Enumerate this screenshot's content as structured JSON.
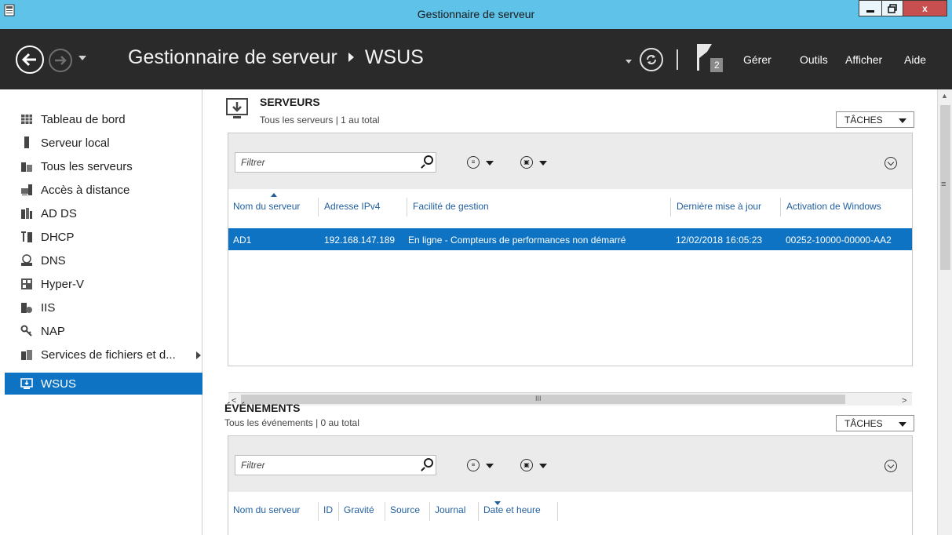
{
  "window": {
    "title": "Gestionnaire de serveur",
    "min_glyph": "▁",
    "max_glyph": "❐",
    "close_glyph": "x"
  },
  "header": {
    "app_name": "Gestionnaire de serveur",
    "current_page": "WSUS",
    "notification_count": "2",
    "menus": [
      "Gérer",
      "Outils",
      "Afficher",
      "Aide"
    ]
  },
  "sidebar": {
    "items": [
      {
        "label": "Tableau de bord",
        "icon": "dashboard-icon"
      },
      {
        "label": "Serveur local",
        "icon": "local-server-icon"
      },
      {
        "label": "Tous les serveurs",
        "icon": "all-servers-icon"
      },
      {
        "label": "Accès à distance",
        "icon": "remote-access-icon"
      },
      {
        "label": "AD DS",
        "icon": "ad-ds-icon"
      },
      {
        "label": "DHCP",
        "icon": "dhcp-icon"
      },
      {
        "label": "DNS",
        "icon": "dns-icon"
      },
      {
        "label": "Hyper-V",
        "icon": "hyper-v-icon"
      },
      {
        "label": "IIS",
        "icon": "iis-icon"
      },
      {
        "label": "NAP",
        "icon": "nap-icon"
      },
      {
        "label": "Services de fichiers et d...",
        "icon": "file-services-icon"
      },
      {
        "label": "WSUS",
        "icon": "wsus-icon",
        "active": true
      }
    ]
  },
  "servers": {
    "title": "SERVEURS",
    "subtitle": "Tous les serveurs | 1 au total",
    "tasks_label": "TÂCHES",
    "filter_placeholder": "Filtrer",
    "columns": [
      "Nom du serveur",
      "Adresse IPv4",
      "Facilité de gestion",
      "Dernière mise à jour",
      "Activation de Windows"
    ],
    "rows": [
      [
        "AD1",
        "192.168.147.189",
        "En ligne - Compteurs de performances non démarré",
        "12/02/2018 16:05:23",
        "00252-10000-00000-AA2"
      ]
    ],
    "scroll_left": "<",
    "scroll_right": ">",
    "scroll_grip": "III"
  },
  "events": {
    "title": "ÉVÉNEMENTS",
    "subtitle": "Tous les événements | 0 au total",
    "tasks_label": "TÂCHES",
    "filter_placeholder": "Filtrer",
    "columns": [
      "Nom du serveur",
      "ID",
      "Gravité",
      "Source",
      "Journal",
      "Date et heure"
    ]
  },
  "colors": {
    "titlebar": "#5ec2e9",
    "header": "#2a2a2a",
    "accent": "#0e73c2",
    "column_header_text": "#1f5e9e"
  }
}
